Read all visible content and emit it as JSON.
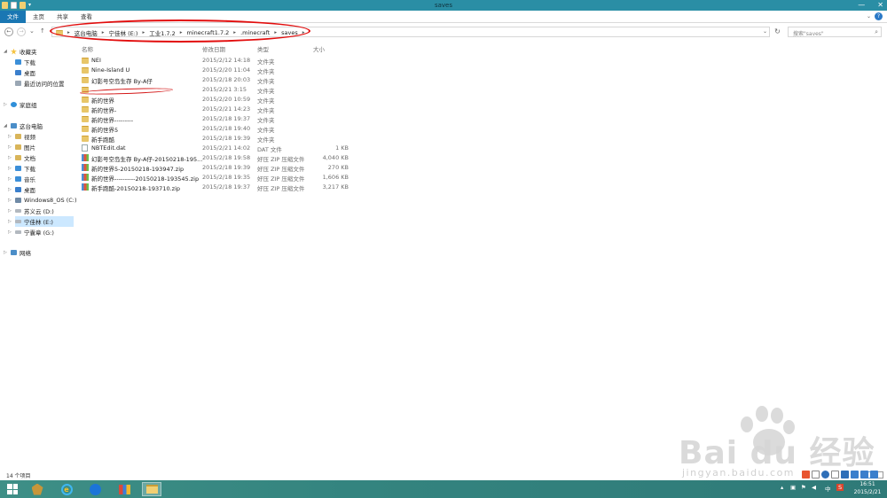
{
  "window": {
    "title": "saves",
    "minimize": "—",
    "close": "✕"
  },
  "ribbon": {
    "tabs": [
      "文件",
      "主页",
      "共享",
      "查看"
    ],
    "help": "?",
    "collapse": "⌄"
  },
  "nav": {
    "back": "←",
    "forward": "→",
    "recent": "⌄",
    "up": "↑",
    "breadcrumb": [
      "这台电脑",
      "宁佳林 (E:)",
      "工业1.7.2",
      "minecraft1.7.2",
      ".minecraft",
      "saves"
    ],
    "dropdown": "⌄",
    "refresh": "↻",
    "search_placeholder": "搜索\"saves\"",
    "search_icon": "⌕"
  },
  "sidebar": {
    "favorites": {
      "label": "收藏夹",
      "items": [
        "下载",
        "桌面",
        "最近访问的位置"
      ]
    },
    "homegroup": "家庭组",
    "thispc": {
      "label": "这台电脑",
      "items": [
        "视频",
        "图片",
        "文档",
        "下载",
        "音乐",
        "桌面",
        "Windows8_OS (C:)",
        "苏义云 (D:)",
        "宁佳林 (E:)",
        "宁囊章 (G:)"
      ]
    },
    "network": "网络"
  },
  "columns": {
    "name": "名称",
    "date": "修改日期",
    "type": "类型",
    "size": "大小"
  },
  "files": [
    {
      "icon": "folder",
      "name": "NEI",
      "date": "2015/2/12 14:18",
      "type": "文件夹",
      "size": ""
    },
    {
      "icon": "folder",
      "name": "Nine-Island U",
      "date": "2015/2/20 11:04",
      "type": "文件夹",
      "size": ""
    },
    {
      "icon": "folder",
      "name": "幻影号空岛生存 By-A仔",
      "date": "2015/2/18 20:03",
      "type": "文件夹",
      "size": ""
    },
    {
      "icon": "folder",
      "name": "",
      "date": "2015/2/21 3:15",
      "type": "文件夹",
      "size": ""
    },
    {
      "icon": "folder",
      "name": "新的世界",
      "date": "2015/2/20 10:59",
      "type": "文件夹",
      "size": ""
    },
    {
      "icon": "folder",
      "name": "新的世界-",
      "date": "2015/2/21 14:23",
      "type": "文件夹",
      "size": ""
    },
    {
      "icon": "folder",
      "name": "新的世界---------",
      "date": "2015/2/18 19:37",
      "type": "文件夹",
      "size": ""
    },
    {
      "icon": "folder",
      "name": "新的世界5",
      "date": "2015/2/18 19:40",
      "type": "文件夹",
      "size": ""
    },
    {
      "icon": "folder",
      "name": "新手跑酷",
      "date": "2015/2/18 19:39",
      "type": "文件夹",
      "size": ""
    },
    {
      "icon": "file",
      "name": "NBTEdit.dat",
      "date": "2015/2/21 14:02",
      "type": "DAT 文件",
      "size": "1 KB"
    },
    {
      "icon": "zip",
      "name": "幻影号空岛生存 By-A仔-20150218-195...",
      "date": "2015/2/18 19:58",
      "type": "好压 ZIP 压缩文件",
      "size": "4,040 KB"
    },
    {
      "icon": "zip",
      "name": "新的世界5-20150218-193947.zip",
      "date": "2015/2/18 19:39",
      "type": "好压 ZIP 压缩文件",
      "size": "270 KB"
    },
    {
      "icon": "zip",
      "name": "新的世界----------20150218-193545.zip",
      "date": "2015/2/18 19:35",
      "type": "好压 ZIP 压缩文件",
      "size": "1,606 KB"
    },
    {
      "icon": "zip",
      "name": "新手跑酷-20150218-193710.zip",
      "date": "2015/2/18 19:37",
      "type": "好压 ZIP 压缩文件",
      "size": "3,217 KB"
    }
  ],
  "status": {
    "count": "14 个项目"
  },
  "taskbar": {
    "tray_lang": "中",
    "tray_s": "S",
    "clock_time": "16:51",
    "clock_date": "2015/2/21"
  },
  "watermark": {
    "brand": "Bai du 经验",
    "url": "jingyan.baidu.com"
  },
  "colors": {
    "titlebar": "#2a8ea5",
    "file_tab": "#1a77b3",
    "taskbar": "#3a8a82",
    "annotation": "#e20d0d"
  }
}
